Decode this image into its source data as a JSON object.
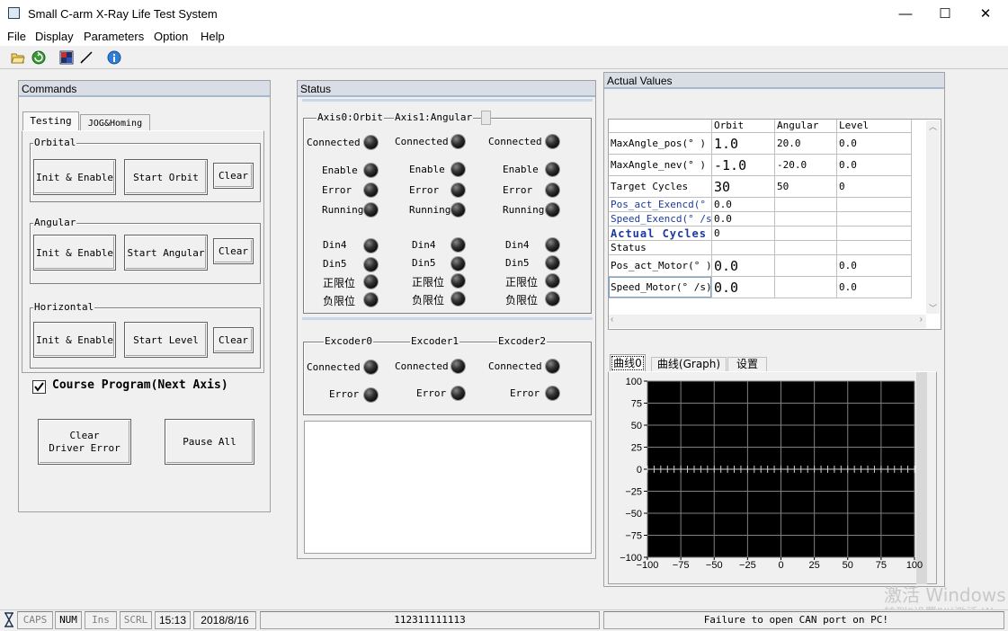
{
  "window": {
    "title": "Small C-arm X-Ray Life Test System",
    "minimize": "—",
    "maximize": "☐",
    "close": "✕"
  },
  "menu": [
    "File",
    "Display",
    "Parameters",
    "Option",
    "Help"
  ],
  "toolbar_icons": [
    "open-folder-icon",
    "refresh-icon",
    "grid-icon",
    "curve-icon",
    "info-icon"
  ],
  "commands": {
    "header": "Commands",
    "tabs": [
      "Testing",
      "JOG&Homing"
    ],
    "orbital": {
      "label": "Orbital",
      "init": "Init & Enable",
      "start": "Start Orbit",
      "clear": "Clear"
    },
    "angular": {
      "label": "Angular",
      "init": "Init & Enable",
      "start": "Start Angular",
      "clear": "Clear"
    },
    "horizontal": {
      "label": "Horizontal",
      "init": "Init & Enable",
      "start": "Start Level",
      "clear": "Clear"
    },
    "course_program": "Course Program(Next Axis)",
    "course_checked": true,
    "clear_driver_1": "Clear",
    "clear_driver_2": "Driver Error",
    "pause_all": "Pause All"
  },
  "status": {
    "header": "Status",
    "axis_tabs": [
      "Axis0:Orbit",
      "Axis1:Angular"
    ],
    "axes": [
      {
        "connected": "Connected",
        "enable": "Enable",
        "error": "Error",
        "running": "Running",
        "din4": "Din4",
        "din5": "Din5",
        "pos_limit": "正限位",
        "neg_limit": "负限位"
      },
      {
        "connected": "Connected",
        "enable": "Enable",
        "error": "Error",
        "running": "Running",
        "din4": "Din4",
        "din5": "Din5",
        "pos_limit": "正限位",
        "neg_limit": "负限位"
      },
      {
        "connected": "Connected",
        "enable": "Enable",
        "error": "Error",
        "running": "Running",
        "din4": "Din4",
        "din5": "Din5",
        "pos_limit": "正限位",
        "neg_limit": "负限位"
      }
    ],
    "encoders": [
      {
        "title": "Excoder0",
        "connected": "Connected",
        "error": "Error"
      },
      {
        "title": "Excoder1",
        "connected": "Connected",
        "error": "Error"
      },
      {
        "title": "Excoder2",
        "connected": "Connected",
        "error": "Error"
      }
    ]
  },
  "actual": {
    "header": "Actual Values",
    "columns": [
      "",
      "Orbit",
      "Angular",
      "Level"
    ],
    "rows": [
      {
        "name": "MaxAngle_pos(° )",
        "orbit": "1.0",
        "angular": "20.0",
        "level": "0.0"
      },
      {
        "name": "MaxAngle_nev(° )",
        "orbit": "-1.0",
        "angular": "-20.0",
        "level": "0.0"
      },
      {
        "name": "Target Cycles",
        "orbit": "30",
        "angular": "50",
        "level": "0"
      },
      {
        "name": "Pos_act_Exencd(° )",
        "orbit": "0.0",
        "angular": "",
        "level": ""
      },
      {
        "name": "Speed_Exencd(° /s)",
        "orbit": "0.0",
        "angular": "",
        "level": ""
      },
      {
        "name": "Actual Cycles",
        "orbit": "0",
        "angular": "",
        "level": ""
      },
      {
        "name": "Status",
        "orbit": "",
        "angular": "",
        "level": ""
      },
      {
        "name": "Pos_act_Motor(° )",
        "orbit": "0.0",
        "angular": "",
        "level": "0.0"
      },
      {
        "name": "Speed_Motor(° /s)",
        "orbit": "0.0",
        "angular": "",
        "level": "0.0"
      }
    ],
    "graph_tabs": [
      "曲线0",
      "曲线(Graph)",
      "设置"
    ]
  },
  "chart_data": {
    "type": "line",
    "x_ticks": [
      "-100",
      "-75",
      "-50",
      "-25",
      "0",
      "25",
      "50",
      "75",
      "100"
    ],
    "y_ticks": [
      "100",
      "75",
      "50",
      "25",
      "0",
      "-25",
      "-50",
      "-75",
      "-100"
    ],
    "xlim": [
      -100,
      100
    ],
    "ylim": [
      -100,
      100
    ],
    "grid": true,
    "background": "#000000",
    "grid_color": "#808080",
    "series": [
      {
        "values": []
      }
    ]
  },
  "statusbar": {
    "caps": "CAPS",
    "num": "NUM",
    "ins": "Ins",
    "scrl": "SCRL",
    "time": "15:13",
    "date": "2018/8/16",
    "code": "112311111113",
    "message": "Failure to open CAN port on PC!"
  },
  "watermark": {
    "line1": "激活 Windows",
    "line2": "转到“设置”以激活 W"
  }
}
